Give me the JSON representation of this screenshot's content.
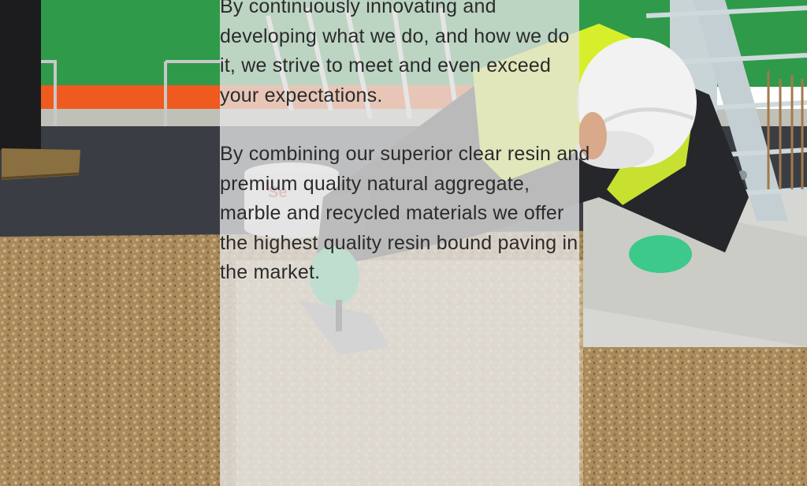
{
  "hero": {
    "paragraphs": [
      "By continuously innovating and developing what we do, and how we do it, we strive to meet and even exceed your expectations.",
      "By combining our superior clear resin and premium quality natural aggregate, marble and recycled materials we offer the highest quality resin bound paving in the market."
    ]
  },
  "photo": {
    "bucket_label": "Se"
  },
  "colors": {
    "fence_green": "#2f9a4a",
    "hoarding_orange": "#ef5a1f",
    "asphalt": "#3a3d44",
    "gravel": "#a98a5c",
    "hi_vis": "#d7ef2a",
    "glove": "#3cc98a",
    "helmet": "#f2f2f2",
    "panel_overlay": "#e4e4e4",
    "text": "#2b2b2b"
  }
}
